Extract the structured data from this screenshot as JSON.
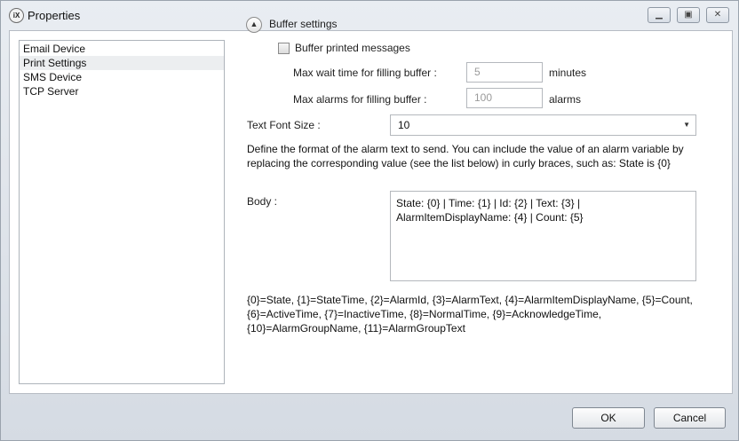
{
  "window": {
    "title": "Properties",
    "icon": "ix-icon"
  },
  "sidebar": {
    "items": [
      {
        "label": "Email Device",
        "selected": false
      },
      {
        "label": "Print Settings",
        "selected": true
      },
      {
        "label": "SMS Device",
        "selected": false
      },
      {
        "label": "TCP Server",
        "selected": false
      }
    ]
  },
  "buffer": {
    "section_label": "Buffer settings",
    "checkbox_label": "Buffer printed messages",
    "checkbox_checked": false,
    "max_wait_label": "Max wait time for filling buffer :",
    "max_wait_value": "5",
    "max_wait_unit": "minutes",
    "max_alarms_label": "Max alarms for filling buffer :",
    "max_alarms_value": "100",
    "max_alarms_unit": "alarms"
  },
  "font_size": {
    "label": "Text Font Size :",
    "value": "10"
  },
  "description": "Define the format of the alarm text to send. You can include the value of an alarm variable by replacing the corresponding value (see the list below) in curly braces, such as: State is {0}",
  "body": {
    "label": "Body :",
    "value": "State: {0} | Time: {1} | Id: {2} | Text: {3} | AlarmItemDisplayName: {4} | Count: {5}"
  },
  "legend": "{0}=State, {1}=StateTime, {2}=AlarmId, {3}=AlarmText, {4}=AlarmItemDisplayName, {5}=Count, {6}=ActiveTime, {7}=InactiveTime, {8}=NormalTime, {9}=AcknowledgeTime, {10}=AlarmGroupName, {11}=AlarmGroupText",
  "buttons": {
    "ok": "OK",
    "cancel": "Cancel"
  }
}
